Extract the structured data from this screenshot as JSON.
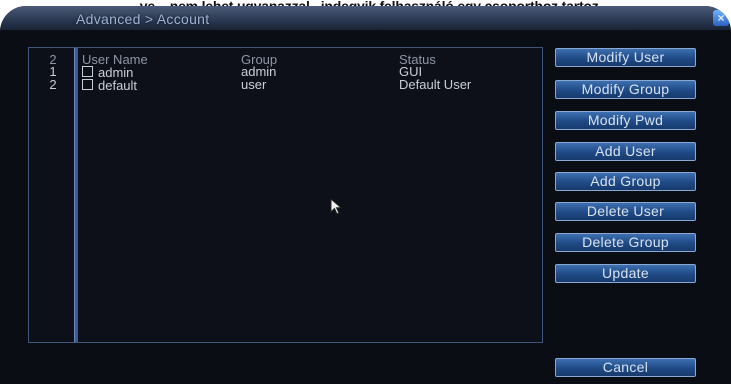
{
  "top_caption": "..ve... nem lehet ugyanazzal...indegyik felhasználó egy csoporthoz tartoz",
  "window": {
    "title": "Advanced > Account",
    "close_icon": "×"
  },
  "list": {
    "header": {
      "count": "2",
      "user_name": "User Name",
      "group": "Group",
      "status": "Status"
    },
    "rows": [
      {
        "index": "1",
        "user_name": "admin",
        "group": "admin",
        "status": "GUI"
      },
      {
        "index": "2",
        "user_name": "default",
        "group": "user",
        "status": "Default User"
      }
    ]
  },
  "buttons": {
    "modify_user": "Modify User",
    "modify_group": "Modify Group",
    "modify_pwd": "Modify Pwd",
    "add_user": "Add User",
    "add_group": "Add Group",
    "delete_user": "Delete User",
    "delete_group": "Delete Group",
    "update": "Update",
    "cancel": "Cancel"
  },
  "colors": {
    "background": "#0b0d14",
    "button_face": "#1f4a86",
    "title_text": "#9fb3d6",
    "close_button": "#2c63c0"
  }
}
